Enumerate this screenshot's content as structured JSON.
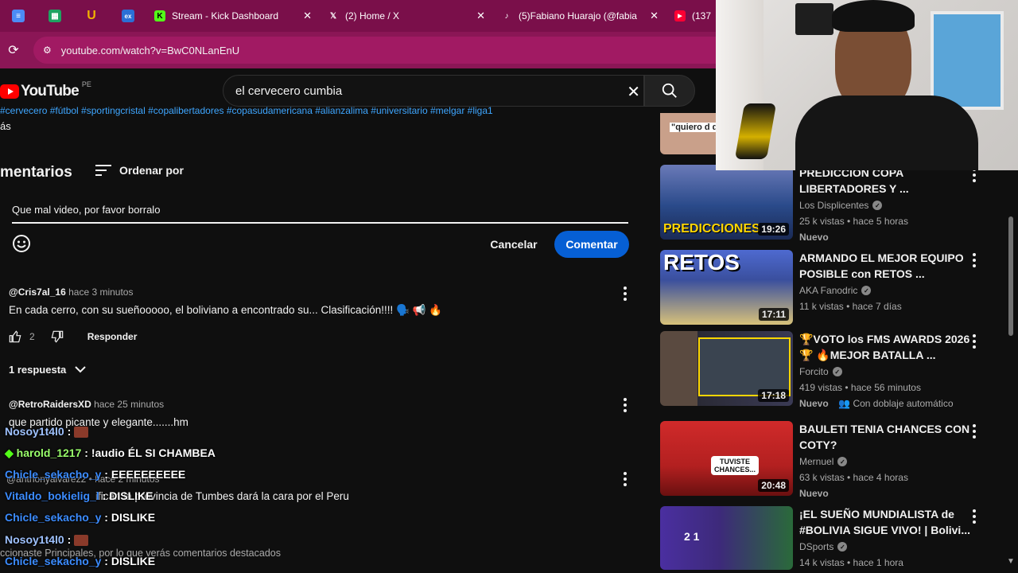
{
  "browser": {
    "pinned_tabs": [
      {
        "icon": "docs-icon",
        "color": "#4c8bf5",
        "glyph": "≡"
      },
      {
        "icon": "sheets-icon",
        "color": "#1ea362",
        "glyph": "▦"
      },
      {
        "icon": "u-icon",
        "color": "#f2b200",
        "glyph": "U"
      },
      {
        "icon": "ex-icon",
        "color": "#2b6fd6",
        "glyph": "ex"
      }
    ],
    "tabs": [
      {
        "label": "Stream - Kick Dashboard",
        "icon": "kick-icon",
        "icon_color": "#53fc18",
        "glyph": "K",
        "close": "✕"
      },
      {
        "label": "(2) Home / X",
        "icon": "x-icon",
        "icon_color": "#000000",
        "glyph": "𝕏",
        "close": "✕"
      },
      {
        "label": "(5)Fabiano Huarajo (@fabia",
        "icon": "tiktok-icon",
        "icon_color": "#000000",
        "glyph": "♪",
        "close": "✕"
      },
      {
        "label": "(137",
        "icon": "youtube-tab-icon",
        "icon_color": "#ff0000",
        "glyph": "▶",
        "close": ""
      }
    ],
    "url": "youtube.com/watch?v=BwC0NLanEnU"
  },
  "youtube": {
    "logo_text": "YouTube",
    "country": "PE",
    "search_value": "el cervecero cumbia",
    "hashtags": "#cervecero #fútbol #sportingcristal #copalibertadores #copasudamericana #alianzalima #universitario #melgar #liga1",
    "more": "ás"
  },
  "comments": {
    "header": "mentarios",
    "sort_label": "Ordenar por",
    "draft_text": "Que mal video, por favor borralo",
    "cancel_label": "Cancelar",
    "submit_label": "Comentar",
    "items": [
      {
        "user": "@Cris7al_16",
        "time": "hace 3 minutos",
        "text": "En cada cerro, con su sueñooooo, el boliviano a encontrado su... Clasificación!!!! 🗣️ 📢 🔥",
        "likes": "2",
        "reply": "Responder"
      },
      {
        "user": "@RetroRaidersXD",
        "time": "hace 25 minutos",
        "text": "que partido picante y elegante.......hm",
        "reply": "Responder"
      }
    ],
    "replies_label": "1 respuesta",
    "under_comment_text": "ifican la provincia de Tumbes dará la cara por el Peru",
    "under_reply_meta": "@anthonyalvarez2 • hace 2 minutos",
    "footnote": "ccionaste Principales, por lo que verás comentarios destacados"
  },
  "chat": [
    {
      "user": "Nosoy1t4l0",
      "msg": "",
      "avatar": true
    },
    {
      "user": "harold_1217",
      "msg": "!audio ÉL SI CHAMBEA",
      "green": true
    },
    {
      "user": "Chicle_sekacho_y",
      "msg": "EEEEEEEEEE"
    },
    {
      "user": "Vitaldo_bokielig_l",
      "msg": "DISLIKE"
    },
    {
      "user": "Chicle_sekacho_y",
      "msg": "DISLIKE"
    },
    {
      "user": "Nosoy1t4l0",
      "msg": "",
      "avatar": true
    },
    {
      "user": "Chicle_sekacho_y",
      "msg": "DISLIKE"
    }
  ],
  "sidebar": {
    "videos": [
      {
        "title": "PREDICCION COPA LIBERTADORES Y ...",
        "channel": "Los Displicentes",
        "verified": true,
        "stats": "25 k vistas • hace 5 horas",
        "badge": "Nuevo",
        "extra": "",
        "duration": "19:26",
        "thumb_color": "#2a4a8a",
        "thumb_text": "PREDICCIONES"
      },
      {
        "title": "ARMANDO EL MEJOR EQUIPO POSIBLE con RETOS ...",
        "channel": "AKA Fanodric",
        "verified": true,
        "stats": "11 k vistas • hace 7 días",
        "badge": "",
        "extra": "",
        "duration": "17:11",
        "thumb_color": "#3a4f9e",
        "thumb_text": "RETOS"
      },
      {
        "title": "🏆VOTO los FMS AWARDS 2026🏆 🔥MEJOR BATALLA ...",
        "channel": "Forcito",
        "verified": true,
        "stats": "419 vistas • hace 56 minutos",
        "badge": "Nuevo",
        "extra": "Con doblaje automático",
        "duration": "17:18",
        "thumb_color": "#4a3a30",
        "thumb_text": ""
      },
      {
        "title": "BAULETI TENIA CHANCES CON COTY?",
        "channel": "Mernuel",
        "verified": true,
        "stats": "63 k vistas • hace 4 horas",
        "badge": "Nuevo",
        "extra": "",
        "duration": "20:48",
        "thumb_color": "#b32020",
        "thumb_text": "TUVISTE CHANCES..."
      },
      {
        "title": "¡EL SUEÑO MUNDIALISTA de #BOLIVIA SIGUE VIVO! | Bolivi...",
        "channel": "DSports",
        "verified": true,
        "stats": "14 k vistas • hace 1 hora",
        "badge": "",
        "extra": "",
        "duration": "",
        "thumb_color": "#3d2a7a",
        "thumb_text": "2 1"
      }
    ],
    "top_thumb_text": "\"quiero d de sue"
  }
}
